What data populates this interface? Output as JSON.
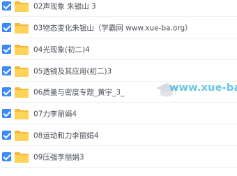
{
  "file_list": {
    "items": [
      {
        "name": "02声现象 朱银山 3",
        "checked": true,
        "icon": "folder-icon"
      },
      {
        "name": "03物态变化朱银山（学霸网 www.xue-ba.org）",
        "checked": true,
        "icon": "folder-icon"
      },
      {
        "name": "04光现象(初二)4",
        "checked": true,
        "icon": "folder-icon"
      },
      {
        "name": "05透镜及其应用(初二)3",
        "checked": true,
        "icon": "folder-icon"
      },
      {
        "name": "06质量与密度专题_黄宇_3_",
        "checked": true,
        "icon": "folder-icon"
      },
      {
        "name": "07力李丽娟4",
        "checked": true,
        "icon": "folder-icon"
      },
      {
        "name": "08运动和力李丽娟4",
        "checked": true,
        "icon": "folder-icon"
      },
      {
        "name": "09压强李丽娟3",
        "checked": true,
        "icon": "folder-icon"
      }
    ]
  },
  "watermark": {
    "text": "www.xue-ba.org",
    "icon": "graduation-cap-logo"
  },
  "colors": {
    "checkbox": "#3b8cff",
    "folder": "#f7c548",
    "text": "#4a4f57",
    "watermark": "#3fb8df"
  }
}
